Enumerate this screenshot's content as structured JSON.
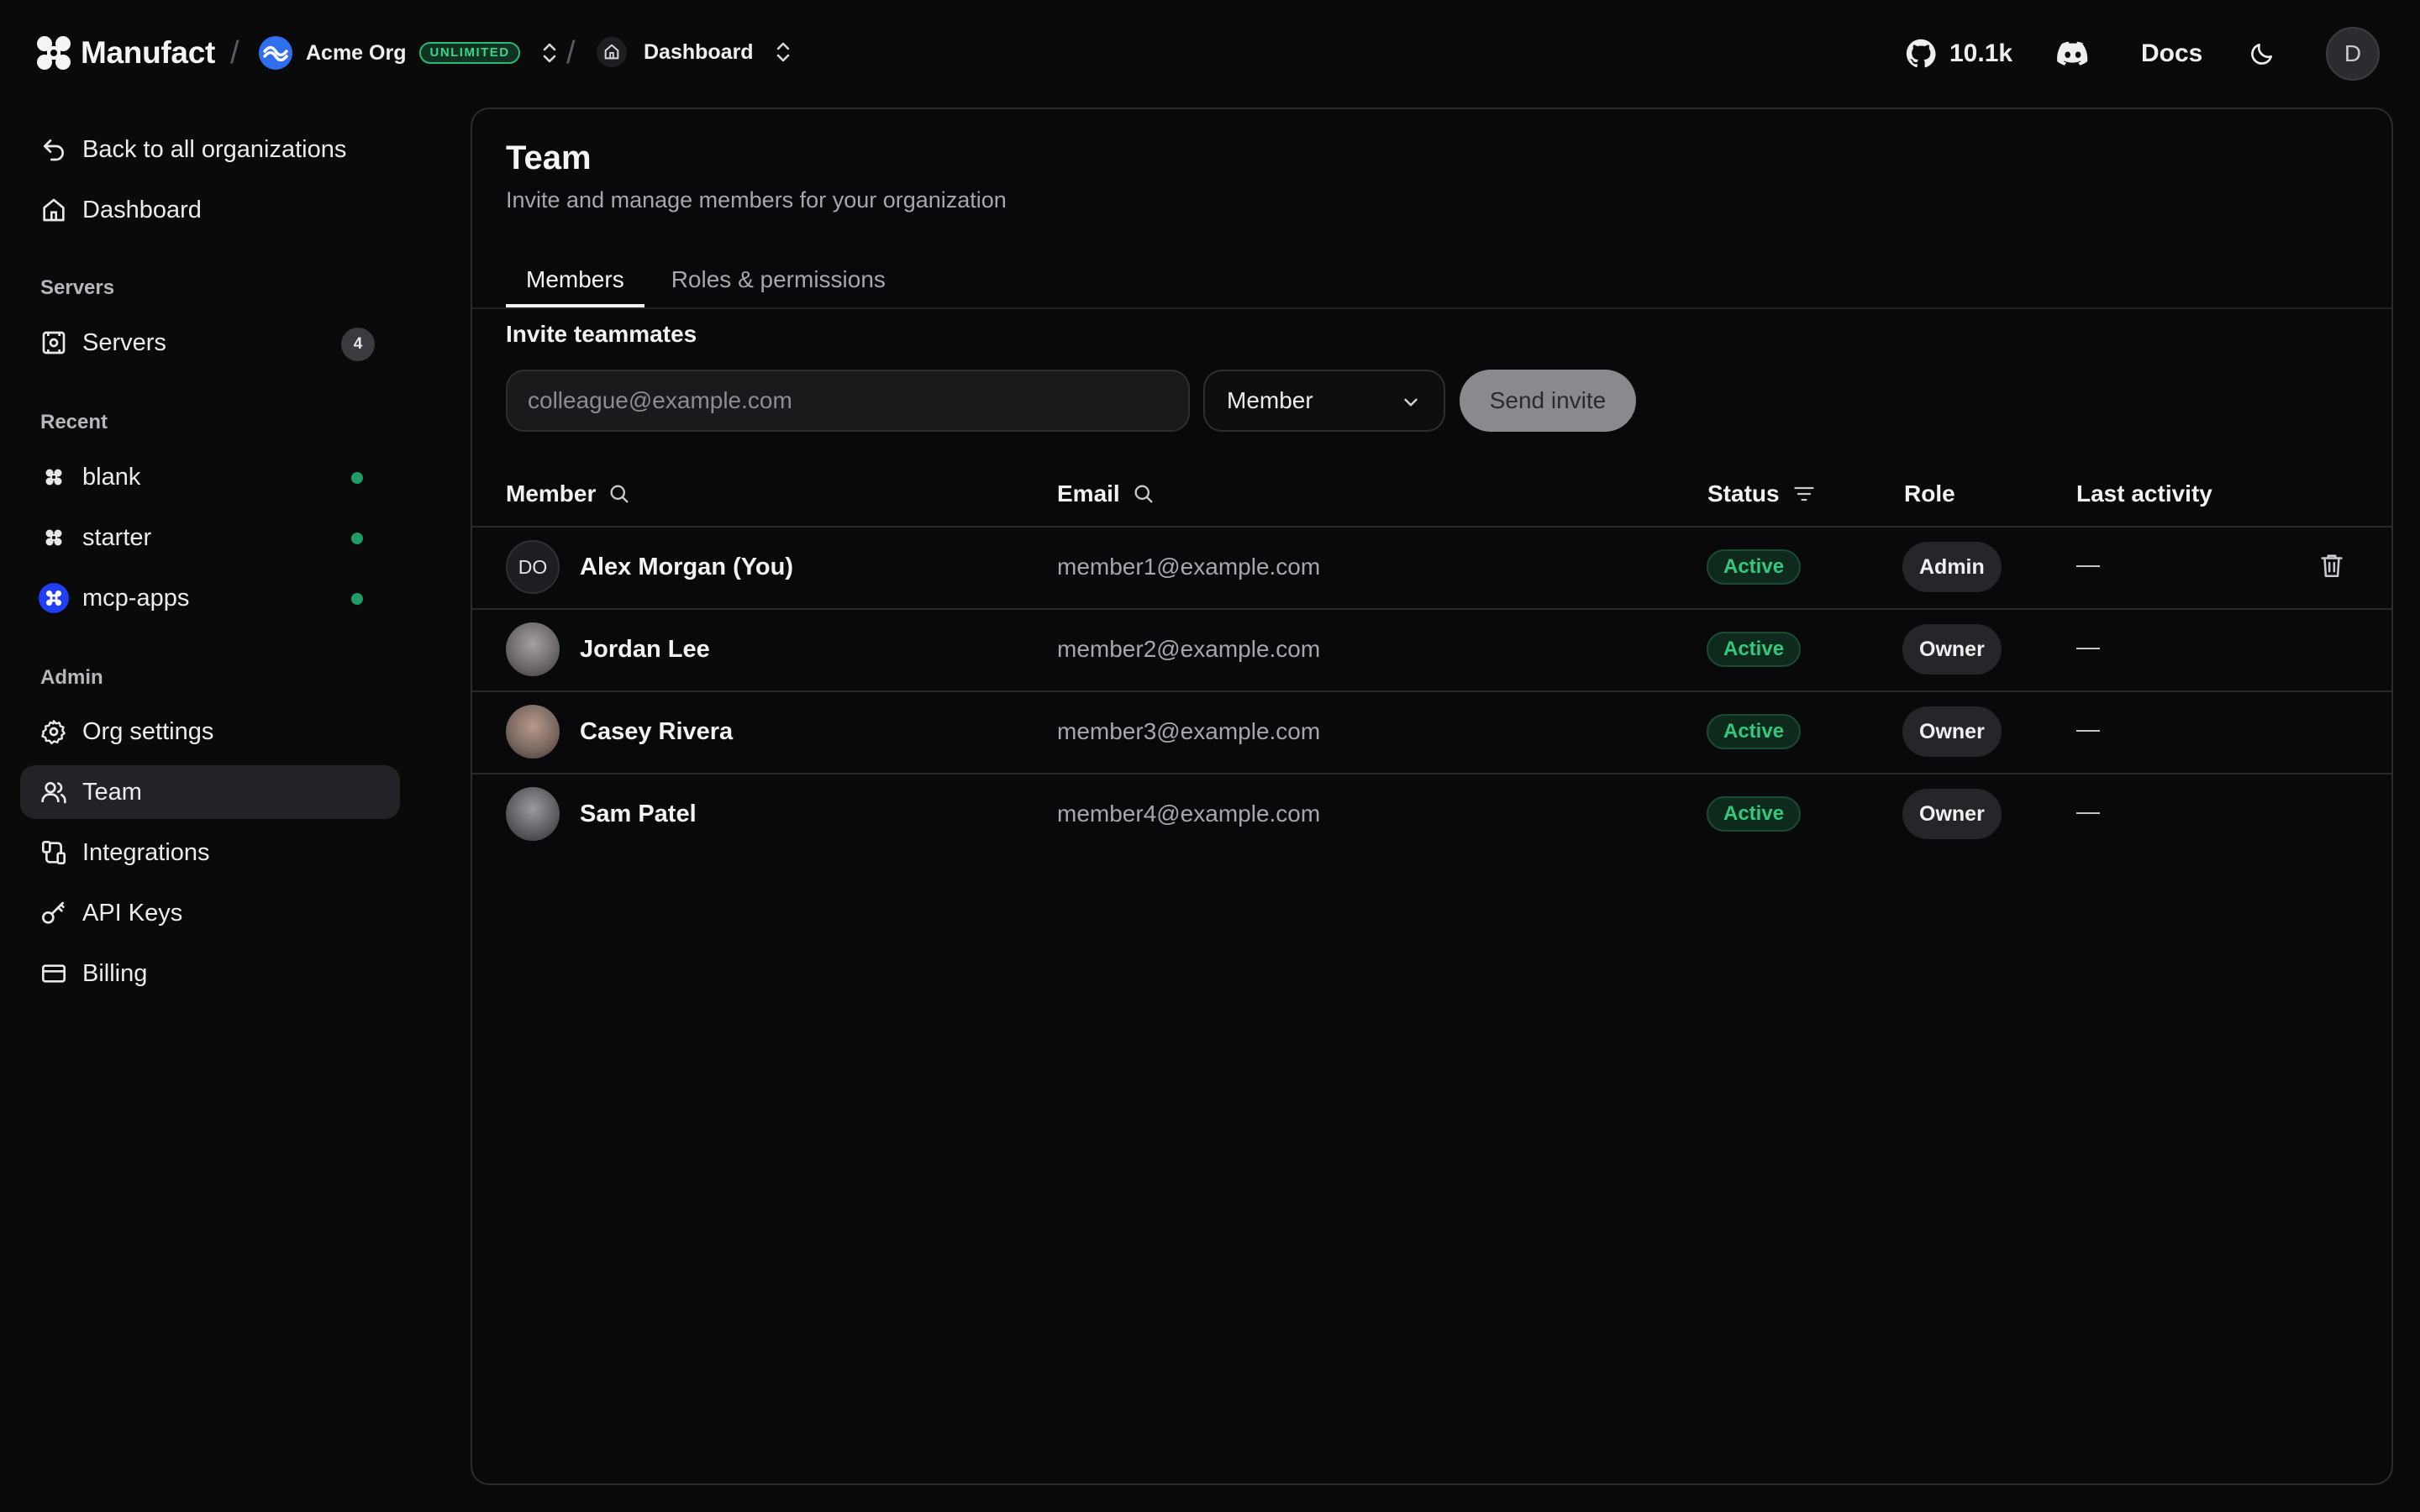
{
  "header": {
    "brand": "Manufact",
    "separator": "/",
    "org_name": "Acme Org",
    "org_badge": "UNLIMITED",
    "page_crumb": "Dashboard",
    "github_stars": "10.1k",
    "docs_label": "Docs",
    "user_initial": "D"
  },
  "sidebar": {
    "back_label": "Back to all organizations",
    "dashboard_label": "Dashboard",
    "servers_section": "Servers",
    "servers_label": "Servers",
    "servers_count": "4",
    "recent_section": "Recent",
    "recent_items": [
      {
        "label": "blank",
        "status_color": "#1e9e65"
      },
      {
        "label": "starter",
        "status_color": "#1e9e65"
      },
      {
        "label": "mcp-apps",
        "status_color": "#1e9e65"
      }
    ],
    "admin_section": "Admin",
    "admin_items": [
      {
        "label": "Org settings",
        "icon": "gear-icon"
      },
      {
        "label": "Team",
        "icon": "users-icon",
        "active": true
      },
      {
        "label": "Integrations",
        "icon": "integrations-icon"
      },
      {
        "label": "API Keys",
        "icon": "key-icon"
      },
      {
        "label": "Billing",
        "icon": "credit-card-icon"
      }
    ]
  },
  "main": {
    "title": "Team",
    "subtitle": "Invite and manage members for your organization",
    "tabs": [
      {
        "label": "Members",
        "active": true
      },
      {
        "label": "Roles & permissions",
        "active": false
      }
    ],
    "invite": {
      "label": "Invite teammates",
      "email_placeholder": "colleague@example.com",
      "role_value": "Member",
      "send_label": "Send invite"
    },
    "table": {
      "columns": [
        "Member",
        "Email",
        "Status",
        "Role",
        "Last activity"
      ],
      "rows": [
        {
          "initials": "DO",
          "name": "Alex Morgan (You)",
          "email": "member1@example.com",
          "status": "Active",
          "role": "Admin",
          "last_activity": "—"
        },
        {
          "initials": "",
          "name": "Jordan Lee",
          "email": "member2@example.com",
          "status": "Active",
          "role": "Owner",
          "last_activity": "—"
        },
        {
          "initials": "",
          "name": "Casey Rivera",
          "email": "member3@example.com",
          "status": "Active",
          "role": "Owner",
          "last_activity": "—"
        },
        {
          "initials": "",
          "name": "Sam Patel",
          "email": "member4@example.com",
          "status": "Active",
          "role": "Owner",
          "last_activity": "—"
        }
      ]
    }
  },
  "colors": {
    "background": "#0a0a0b",
    "accent_green": "#34c77e",
    "active_nav": "#232327"
  }
}
